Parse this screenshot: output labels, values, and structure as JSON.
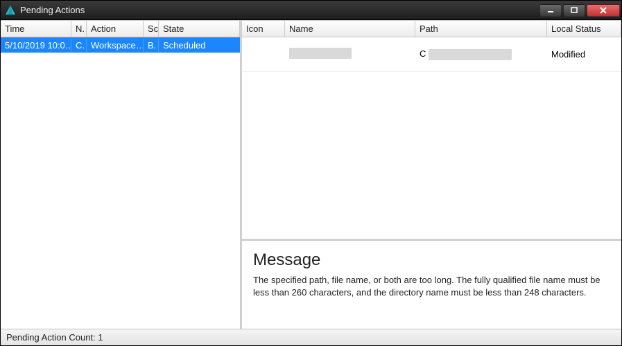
{
  "window": {
    "title": "Pending Actions"
  },
  "left_grid": {
    "headers": {
      "time": "Time",
      "n": "N.",
      "action": "Action",
      "sc": "Sc",
      "state": "State"
    },
    "rows": [
      {
        "time": "5/10/2019 10:0…",
        "n": "C.",
        "action": "Workspace…",
        "sc": "B.",
        "state": "Scheduled"
      }
    ]
  },
  "right_grid": {
    "headers": {
      "icon": "Icon",
      "name": "Name",
      "path": "Path",
      "status": "Local Status"
    },
    "rows": [
      {
        "name_redacted": true,
        "path_prefix": "C",
        "path_redacted": true,
        "status": "Modified"
      }
    ]
  },
  "message": {
    "heading": "Message",
    "body": "The specified path, file name, or both are too long. The fully qualified file name must be less than 260 characters, and the directory name must be less than 248 characters."
  },
  "statusbar": {
    "text": "Pending Action Count: 1"
  }
}
